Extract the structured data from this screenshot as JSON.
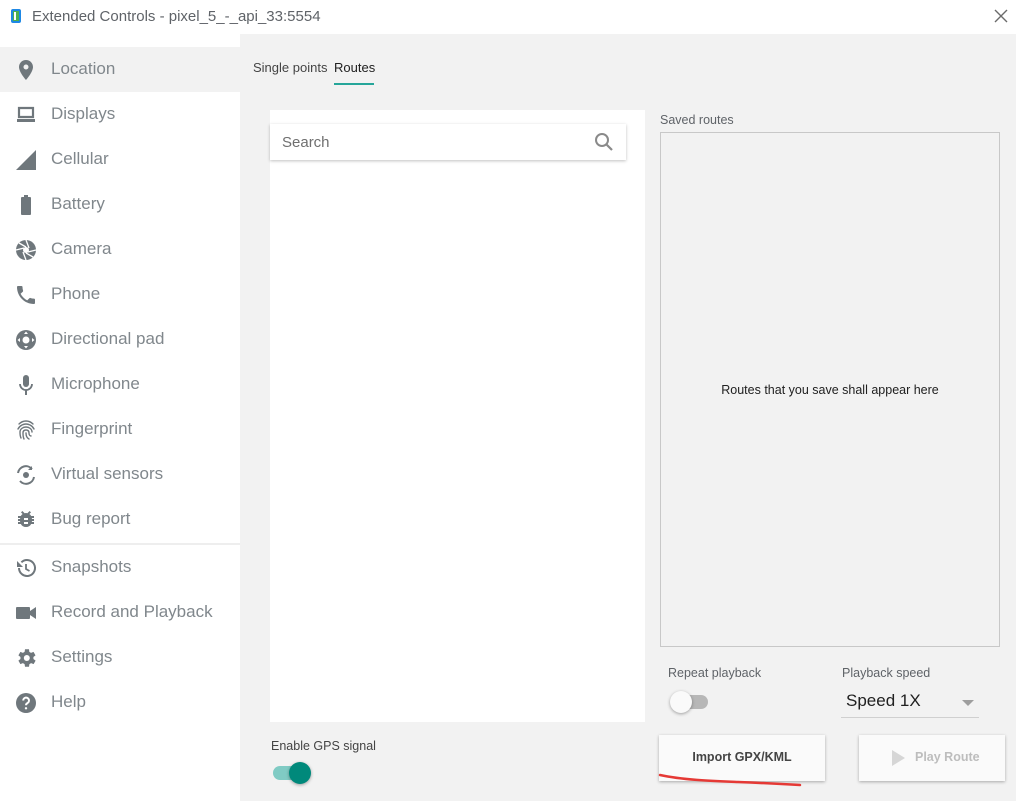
{
  "window": {
    "title": "Extended Controls - pixel_5_-_api_33:5554",
    "app_icon": "emulator-icon",
    "close_icon": "close-icon"
  },
  "sidebar": {
    "items": [
      {
        "label": "Location",
        "icon": "location-pin-icon",
        "active": true
      },
      {
        "label": "Displays",
        "icon": "display-icon"
      },
      {
        "label": "Cellular",
        "icon": "cellular-signal-icon"
      },
      {
        "label": "Battery",
        "icon": "battery-icon"
      },
      {
        "label": "Camera",
        "icon": "camera-aperture-icon"
      },
      {
        "label": "Phone",
        "icon": "phone-icon"
      },
      {
        "label": "Directional pad",
        "icon": "dpad-icon"
      },
      {
        "label": "Microphone",
        "icon": "microphone-icon"
      },
      {
        "label": "Fingerprint",
        "icon": "fingerprint-icon"
      },
      {
        "label": "Virtual sensors",
        "icon": "virtual-sensors-icon"
      },
      {
        "label": "Bug report",
        "icon": "bug-icon"
      },
      {
        "label": "Snapshots",
        "icon": "history-icon"
      },
      {
        "label": "Record and Playback",
        "icon": "videocam-icon"
      },
      {
        "label": "Settings",
        "icon": "gear-icon"
      },
      {
        "label": "Help",
        "icon": "help-icon"
      }
    ]
  },
  "main": {
    "tabs": [
      {
        "label": "Single points",
        "active": false
      },
      {
        "label": "Routes",
        "active": true
      }
    ],
    "search": {
      "placeholder": "Search",
      "value": ""
    },
    "saved_routes": {
      "label": "Saved routes",
      "empty_text": "Routes that you save shall appear here"
    },
    "repeat_playback": {
      "label": "Repeat playback",
      "enabled": false
    },
    "playback_speed": {
      "label": "Playback speed",
      "value": "Speed 1X"
    },
    "gps_signal": {
      "label": "Enable GPS signal",
      "enabled": true
    },
    "buttons": {
      "import": "Import GPX/KML",
      "play": "Play Route",
      "play_enabled": false
    }
  },
  "colors": {
    "accent": "#26a69a",
    "toggle_on_thumb": "#00897b",
    "sidebar_text": "#80878c",
    "panel_bg": "#f2f2f2",
    "annotation_red": "#e53935"
  }
}
